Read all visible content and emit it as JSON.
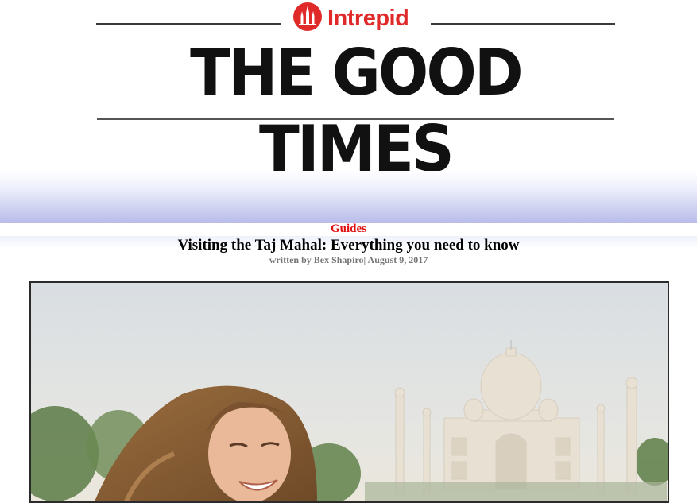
{
  "brand": {
    "name": "Intrepid",
    "color": "#e02a2a",
    "icon": "intrepid-logo-icon"
  },
  "masthead": {
    "title": "THE GOOD TIMES"
  },
  "article": {
    "category": "Guides",
    "title": "Visiting the Taj Mahal: Everything you need to know",
    "byline": "written by Bex Shapiro| August 9, 2017"
  },
  "hero_image": {
    "subject": "woman laughing in front of the Taj Mahal"
  },
  "colors": {
    "category": "#e01010",
    "band": "#b8bce9"
  }
}
